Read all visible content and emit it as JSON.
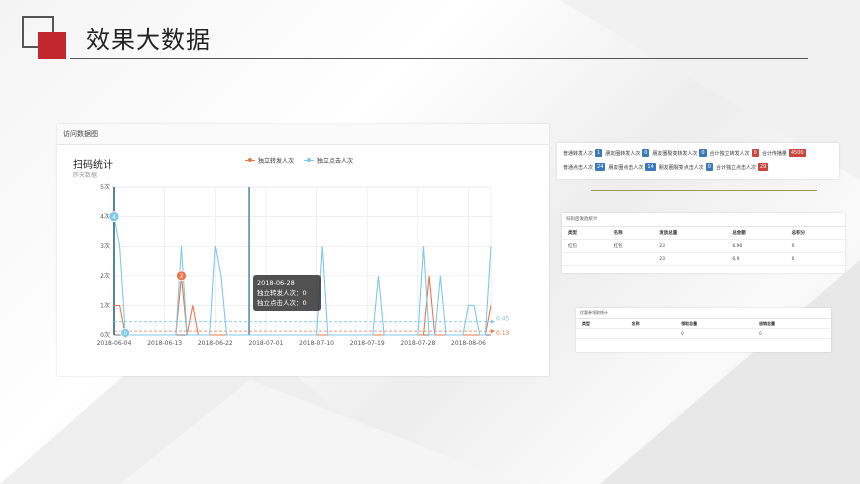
{
  "page": {
    "title": "效果大数据"
  },
  "colors": {
    "accent": "#c1272d",
    "orange": "#e8774a",
    "blue": "#7fc8ea"
  },
  "panel": {
    "header": "访问数据图",
    "chart_title": "扫码统计",
    "chart_subtitle": "昨天数据",
    "legend": [
      "独立转发人次",
      "独立点击人次"
    ]
  },
  "tooltip": {
    "date": "2018-06-28",
    "line1": "独立转发人次：0",
    "line2": "独立点击人次：0"
  },
  "chart_data": {
    "type": "line",
    "title": "扫码统计",
    "ylim": [
      0,
      5
    ],
    "y_ticks": [
      "0次",
      "1次",
      "2次",
      "3次",
      "4次",
      "5次"
    ],
    "x_tick_labels": [
      "2018-06-04",
      "2018-06-13",
      "2018-06-22",
      "2018-07-01",
      "2018-07-10",
      "2018-07-19",
      "2018-07-28",
      "2018-08-06"
    ],
    "x_tick_index": [
      0,
      9,
      18,
      27,
      36,
      45,
      54,
      63
    ],
    "n_points": 68,
    "grid": true,
    "series": [
      {
        "name": "独立转发人次",
        "color": "#e8774a",
        "values": [
          1,
          1,
          0,
          0,
          0,
          0,
          0,
          0,
          0,
          0,
          0,
          0,
          2,
          0,
          1,
          0,
          0,
          0,
          0,
          0,
          0,
          0,
          0,
          0,
          0,
          0,
          0,
          0,
          0,
          0,
          0,
          0,
          0,
          0,
          0,
          0,
          0,
          0,
          0,
          0,
          0,
          0,
          0,
          0,
          0,
          0,
          0,
          0,
          0,
          0,
          0,
          0,
          0,
          0,
          0,
          0,
          2,
          0,
          0,
          0,
          0,
          0,
          0,
          0,
          0,
          0,
          0,
          1
        ],
        "average": 0.13,
        "average_label": "0.13",
        "marked_point": {
          "index": 12,
          "label": "2"
        }
      },
      {
        "name": "独立点击人次",
        "color": "#7fc8ea",
        "values": [
          4,
          3,
          0,
          0,
          0,
          0,
          0,
          0,
          0,
          0,
          0,
          0,
          3,
          0,
          0,
          0,
          0,
          0,
          3,
          2,
          0,
          0,
          0,
          0,
          0,
          0,
          0,
          0,
          0,
          0,
          0,
          0,
          0,
          0,
          0,
          0,
          0,
          3,
          0,
          0,
          0,
          0,
          0,
          0,
          0,
          0,
          0,
          2,
          0,
          0,
          0,
          0,
          0,
          0,
          0,
          3,
          0,
          0,
          2,
          0,
          0,
          0,
          0,
          1,
          1,
          0,
          0,
          3
        ],
        "average": 0.45,
        "average_label": "0.45",
        "marked_point": {
          "index": 0,
          "label": "4"
        },
        "min_point": {
          "index": 2,
          "label": "0"
        }
      }
    ],
    "highlight_index": 24
  },
  "stats": {
    "row1": [
      {
        "label": "普通转发人次",
        "value": "1",
        "style": "blue"
      },
      {
        "label": "朋友圈转发人次",
        "value": "0",
        "style": "blue"
      },
      {
        "label": "朋友圈裂变转发人次",
        "value": "0",
        "style": "blue"
      },
      {
        "label": "合计独立转发人次",
        "value": "0",
        "style": "red"
      },
      {
        "label": "合计传播量",
        "value": "4500",
        "style": "red"
      }
    ],
    "row2": [
      {
        "label": "普通点击人次",
        "value": "24",
        "style": "blue"
      },
      {
        "label": "朋友圈点击人次",
        "value": "14",
        "style": "blue"
      },
      {
        "label": "朋友圈裂变点击人次",
        "value": "0",
        "style": "blue"
      },
      {
        "label": "合计独立点击人次",
        "value": "29",
        "style": "red"
      }
    ]
  },
  "table1": {
    "header": "扫码后发放统计",
    "columns": [
      "类型",
      "名称",
      "发放总量",
      "总金额",
      "总积分"
    ],
    "rows": [
      [
        "红包",
        "红包",
        "23",
        "6.90",
        "0"
      ],
      [
        "",
        "",
        "23",
        "6.9",
        "0"
      ]
    ]
  },
  "table2": {
    "header": "优惠券领取统计",
    "columns": [
      "类型",
      "名称",
      "领取总量",
      "核销总量"
    ],
    "rows": [
      [
        "",
        "",
        "0",
        "0"
      ]
    ]
  }
}
